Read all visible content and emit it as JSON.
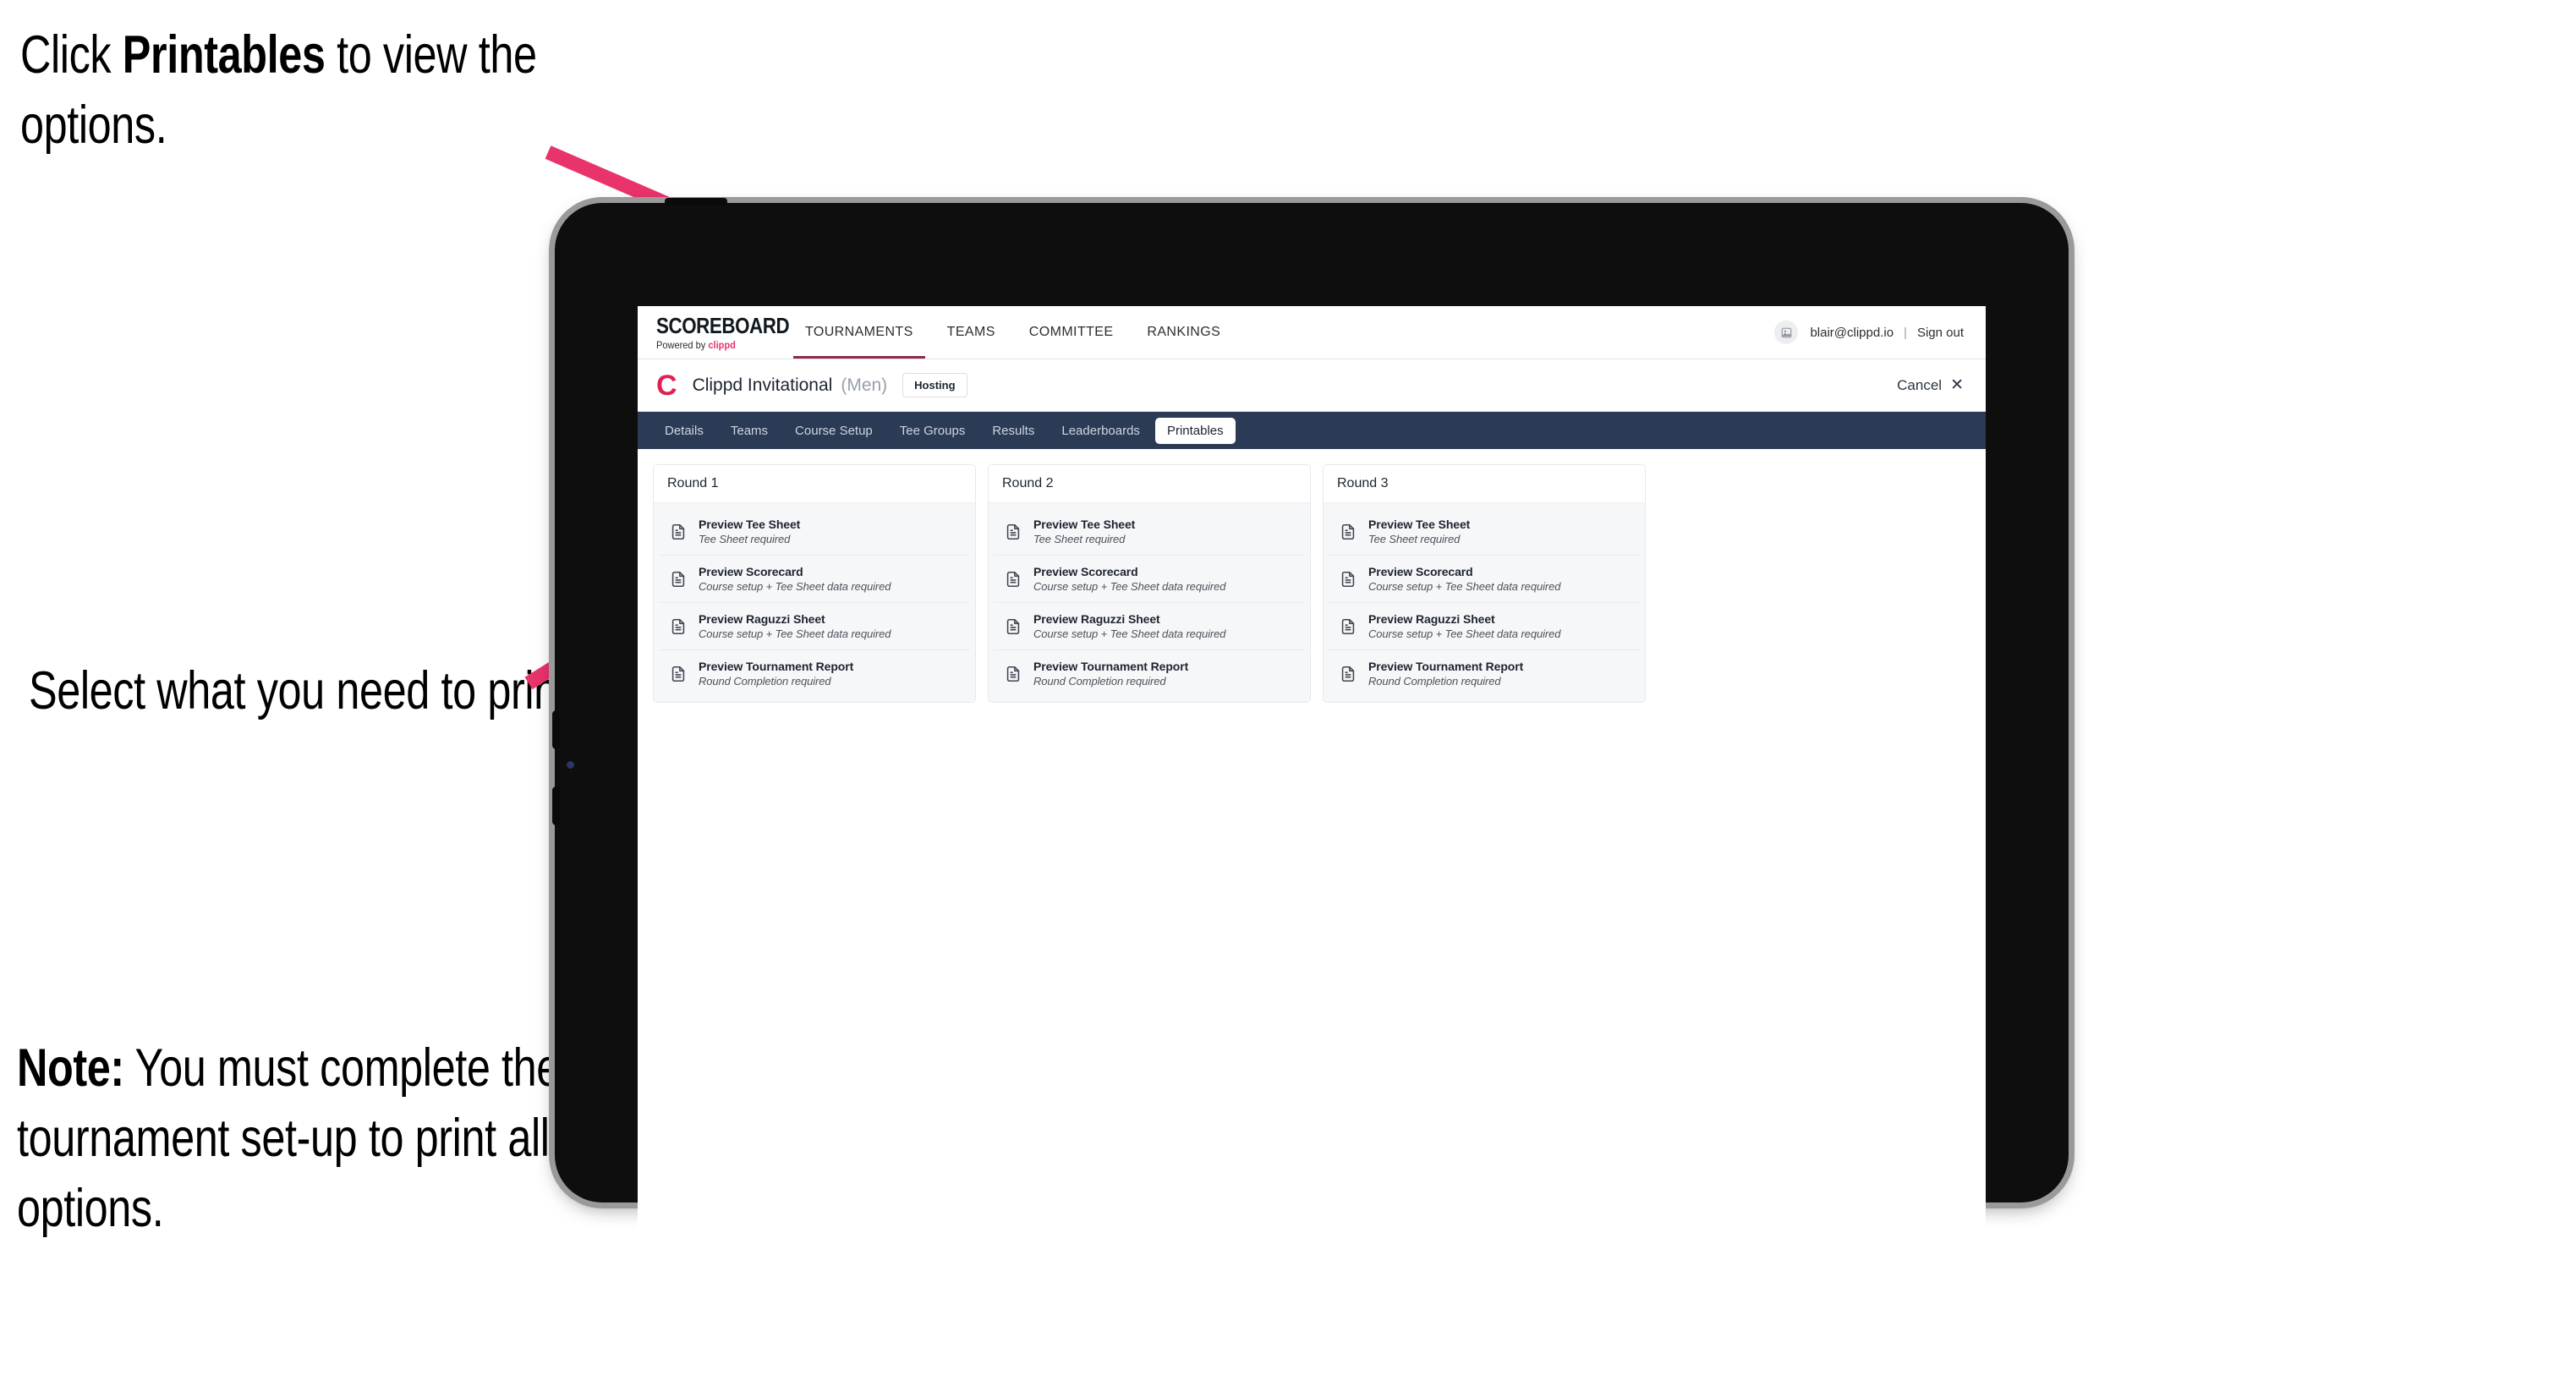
{
  "annotations": [
    {
      "id": "a1",
      "prefix": "Click ",
      "bold": "Printables",
      "suffix": " to view the options."
    },
    {
      "id": "a2",
      "prefix": "",
      "bold": "",
      "suffix": "Select what you need to print."
    },
    {
      "id": "a3",
      "prefix": "",
      "bold": "Note:",
      "suffix": " You must complete the tournament set-up to print all the options."
    }
  ],
  "annotation_text": {
    "line1_pre": "Click ",
    "line1_bold": "Printables",
    "line1_post": " to view the options.",
    "line2": "Select what you need to print.",
    "line3_bold": "Note:",
    "line3_post": " You must complete the tournament set-up to print all the options."
  },
  "colors": {
    "arrow_pink": "#E8336B",
    "brand_pink": "#E0214F",
    "subnav_dark": "#2B3A55",
    "active_underline": "#8E2B4A",
    "card_bg": "#F6F7F8"
  },
  "app": {
    "logo": {
      "wordmark": "SCOREBOARD",
      "powered_by_prefix": "Powered by ",
      "powered_by_brand": "clippd"
    },
    "topnav": [
      {
        "label": "TOURNAMENTS",
        "active": true
      },
      {
        "label": "TEAMS",
        "active": false
      },
      {
        "label": "COMMITTEE",
        "active": false
      },
      {
        "label": "RANKINGS",
        "active": false
      }
    ],
    "account": {
      "avatar_glyph": "⛶",
      "email": "blair@clippd.io",
      "separator": "|",
      "sign_out": "Sign out"
    },
    "tournament": {
      "logo_letter": "C",
      "name": "Clippd Invitational",
      "gender": "(Men)",
      "status_badge": "Hosting",
      "cancel_label": "Cancel",
      "cancel_icon": "✕"
    },
    "subnav": [
      {
        "label": "Details",
        "active": false
      },
      {
        "label": "Teams",
        "active": false
      },
      {
        "label": "Course Setup",
        "active": false
      },
      {
        "label": "Tee Groups",
        "active": false
      },
      {
        "label": "Results",
        "active": false
      },
      {
        "label": "Leaderboards",
        "active": false
      },
      {
        "label": "Printables",
        "active": true
      }
    ],
    "rounds": [
      {
        "title": "Round 1",
        "items": [
          {
            "title": "Preview Tee Sheet",
            "sub": "Tee Sheet required"
          },
          {
            "title": "Preview Scorecard",
            "sub": "Course setup + Tee Sheet data required"
          },
          {
            "title": "Preview Raguzzi Sheet",
            "sub": "Course setup + Tee Sheet data required"
          },
          {
            "title": "Preview Tournament Report",
            "sub": "Round Completion required"
          }
        ]
      },
      {
        "title": "Round 2",
        "items": [
          {
            "title": "Preview Tee Sheet",
            "sub": "Tee Sheet required"
          },
          {
            "title": "Preview Scorecard",
            "sub": "Course setup + Tee Sheet data required"
          },
          {
            "title": "Preview Raguzzi Sheet",
            "sub": "Course setup + Tee Sheet data required"
          },
          {
            "title": "Preview Tournament Report",
            "sub": "Round Completion required"
          }
        ]
      },
      {
        "title": "Round 3",
        "items": [
          {
            "title": "Preview Tee Sheet",
            "sub": "Tee Sheet required"
          },
          {
            "title": "Preview Scorecard",
            "sub": "Course setup + Tee Sheet data required"
          },
          {
            "title": "Preview Raguzzi Sheet",
            "sub": "Course setup + Tee Sheet data required"
          },
          {
            "title": "Preview Tournament Report",
            "sub": "Round Completion required"
          }
        ]
      }
    ]
  }
}
